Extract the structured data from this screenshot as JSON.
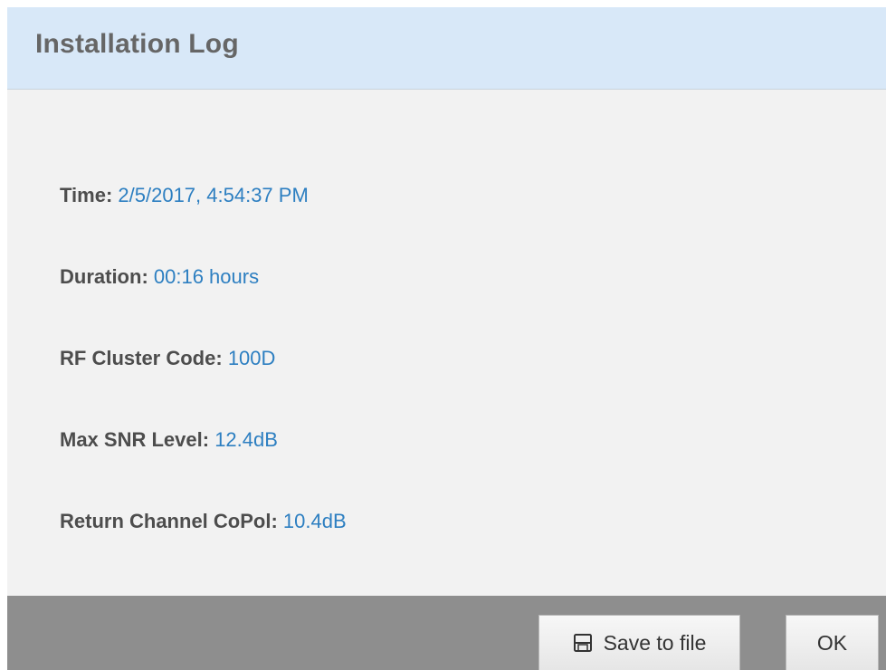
{
  "dialog": {
    "title": "Installation Log",
    "fields": [
      {
        "label": "Time:",
        "value": "2/5/2017, 4:54:37 PM"
      },
      {
        "label": "Duration:",
        "value": "00:16 hours"
      },
      {
        "label": "RF Cluster Code:",
        "value": "100D"
      },
      {
        "label": "Max SNR Level:",
        "value": "12.4dB"
      },
      {
        "label": "Return Channel CoPol:",
        "value": "10.4dB"
      }
    ],
    "buttons": {
      "save_label": "Save to file",
      "save_icon": "floppy-disk-icon",
      "ok_label": "OK"
    }
  },
  "colors": {
    "header_bg": "#d8e8f8",
    "body_bg": "#f2f2f2",
    "footer_bg": "#8e8e8e",
    "value_text": "#2d7fc1",
    "label_text": "#4d4d4d"
  }
}
